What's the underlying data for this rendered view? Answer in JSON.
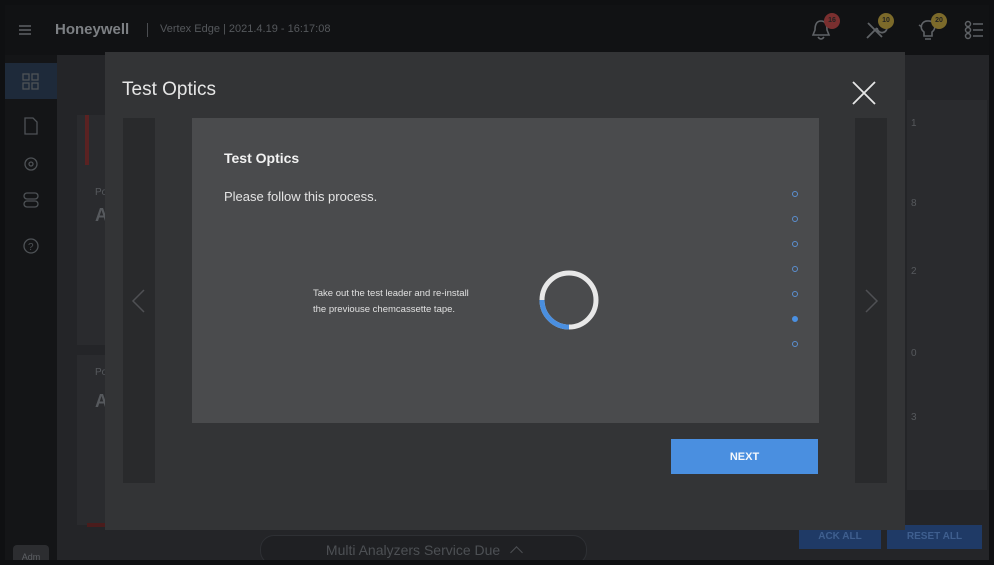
{
  "header": {
    "brand": "Honeywell",
    "subtitle": "Vertex Edge | 2021.4.19 - 16:17:08",
    "icons": [
      {
        "name": "bell-icon",
        "badge": "16",
        "badge_color": "#d9534f"
      },
      {
        "name": "wrench-icon",
        "badge": "10",
        "badge_color": "#e0b83a"
      },
      {
        "name": "bulb-icon",
        "badge": "20",
        "badge_color": "#e0b83a"
      },
      {
        "name": "settings-list-icon",
        "badge": "",
        "badge_color": "#e6e6e6"
      }
    ]
  },
  "sidebar": {
    "items": [
      "grid-icon",
      "document-icon",
      "gear-icon",
      "toggle-icon",
      "help-icon"
    ],
    "user_label": "Adm"
  },
  "background": {
    "card_labels": [
      "Po",
      "A",
      "Po",
      "A"
    ],
    "right_col": [
      "1",
      "8",
      "2",
      "0",
      "3"
    ],
    "ack_all": "ACK ALL",
    "reset_all": "RESET ALL",
    "service_status": "Multi Analyzers Service Due"
  },
  "modal": {
    "title": "Test Optics",
    "panel_title": "Test Optics",
    "panel_subtitle": "Please follow this process.",
    "instruction": "Take out the test leader and re-install the previouse chemcassette tape.",
    "steps_total": 7,
    "active_step": 6,
    "next_label": "NEXT",
    "accent": "#4a8fe0"
  }
}
